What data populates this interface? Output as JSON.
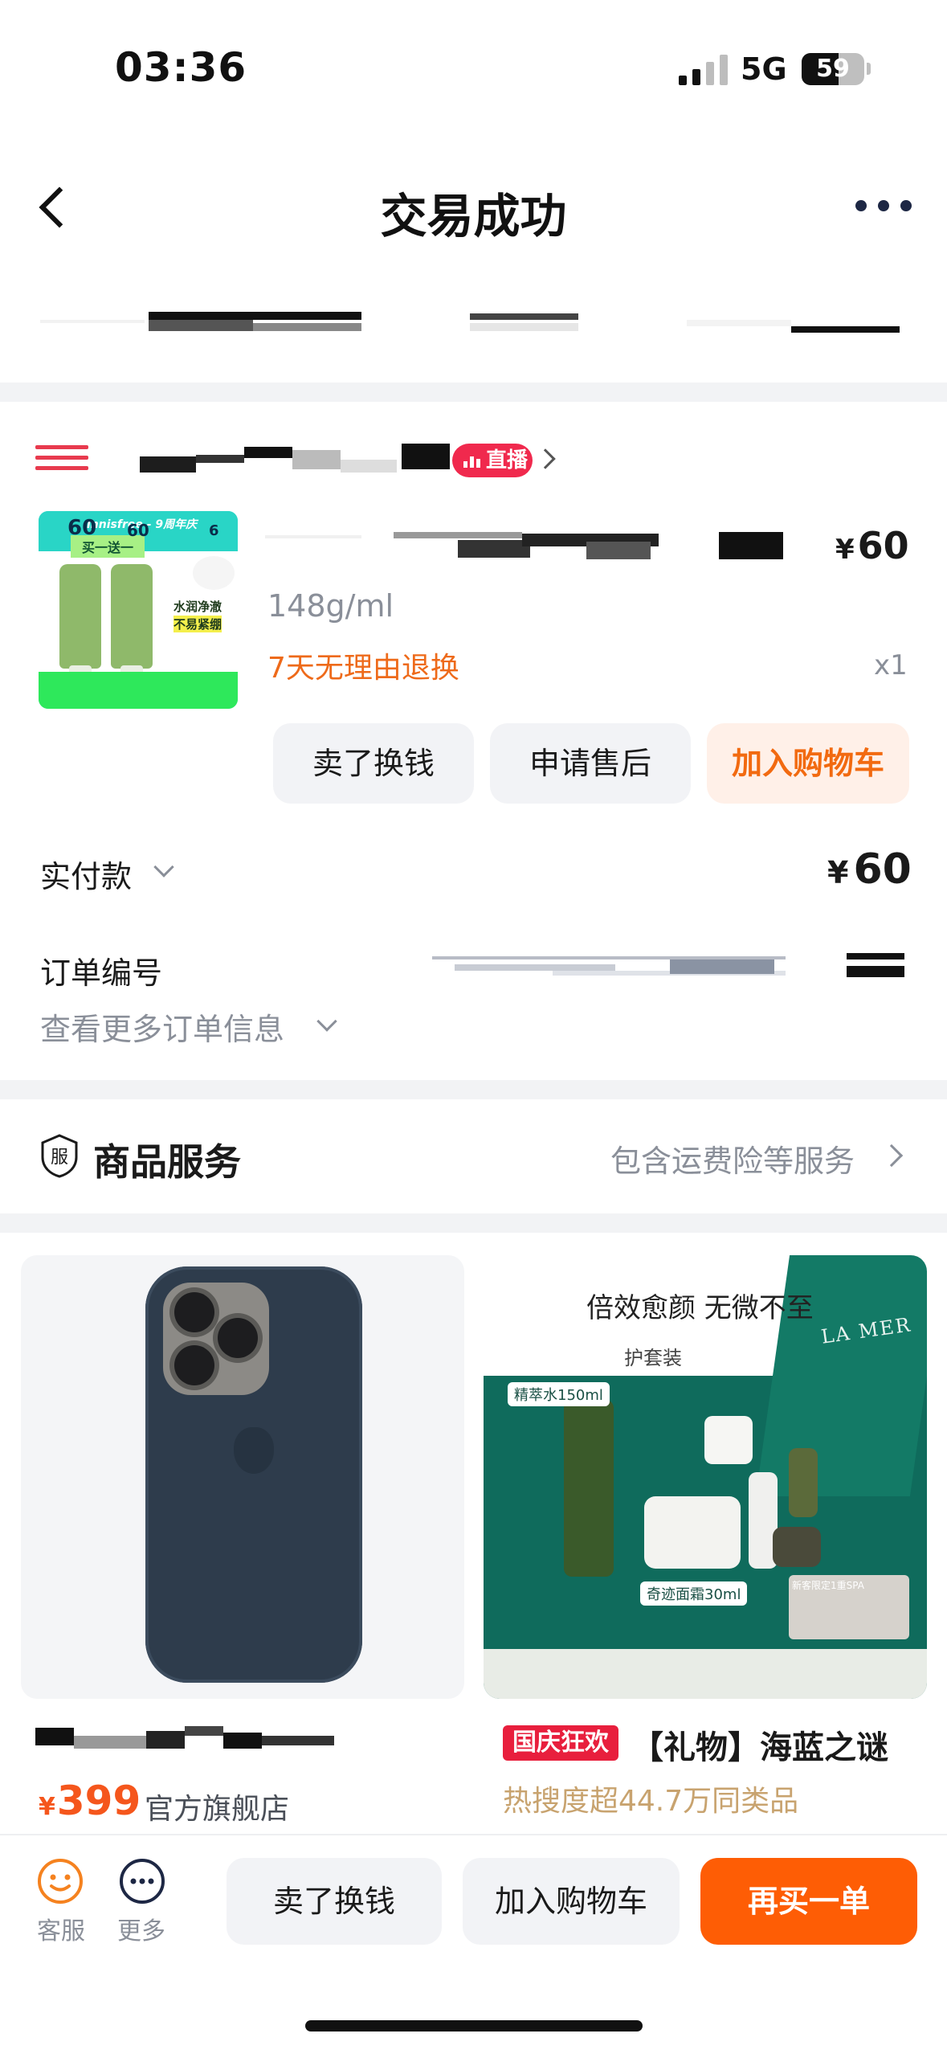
{
  "status_bar": {
    "time": "03:36",
    "network": "5G",
    "battery": "59",
    "battery_level": 0.59
  },
  "nav": {
    "title": "交易成功"
  },
  "shop": {
    "live_label": "直播"
  },
  "product": {
    "thumb_brand": "innisfree - 9周年庆",
    "thumb_tag": "买一送一",
    "thumb_note1": "水润净澈",
    "thumb_note2": "不易紧绷",
    "thumb_price1": "60",
    "thumb_price2": "60",
    "thumb_price3": "6",
    "spec": "148g/ml",
    "return_policy": "7天无理由退换",
    "price_symbol": "¥",
    "price": "60",
    "quantity": "x1",
    "buttons": {
      "sell": "卖了换钱",
      "after_sales": "申请售后",
      "add_cart": "加入购物车"
    }
  },
  "payment": {
    "label": "实付款",
    "symbol": "¥",
    "value": "60"
  },
  "order": {
    "number_label": "订单编号",
    "more_info": "查看更多订单信息"
  },
  "service": {
    "icon_char": "服",
    "title": "商品服务",
    "desc": "包含运费险等服务"
  },
  "recommendations": [
    {
      "price_symbol": "¥",
      "price": "399",
      "store": "官方旗舰店"
    },
    {
      "headline": "倍效愈颜 无微不至",
      "subline": "护套装",
      "logo": "LA MER",
      "chip_1": "精萃水150ml",
      "chip_2": "奇迹面霜30ml",
      "foot_1": "新客限定1重SPA",
      "promo_badge": "国庆狂欢",
      "title": "【礼物】海蓝之谜",
      "hot": "热搜度超44.7万同类品"
    }
  ],
  "bottom_bar": {
    "service_label": "客服",
    "more_label": "更多",
    "sell": "卖了换钱",
    "add_cart": "加入购物车",
    "rebuy": "再买一单"
  },
  "colors": {
    "accent_orange": "#fe5d05",
    "live_red": "#f0294d",
    "policy_orange": "#ee6a1a"
  }
}
